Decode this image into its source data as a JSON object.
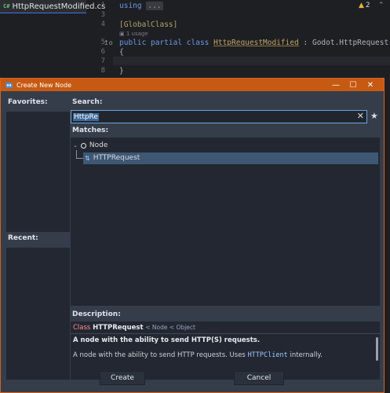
{
  "ide": {
    "tab": {
      "icon": "C#",
      "label": "HttpRequestModified.cs"
    },
    "warnings": {
      "icon": "warning-icon",
      "count": "2"
    },
    "line_numbers": [
      "1",
      "3",
      "4",
      "5",
      "6",
      "7",
      "8"
    ],
    "code": {
      "line1_keyword": "using",
      "line1_fold": "...",
      "line4_attr": "[GlobalClass]",
      "usage_hint": "1 usage",
      "line5_keywords": "public partial class",
      "line5_class": "HttpRequestModified",
      "line5_base": ": Godot.HttpRequest",
      "line6": "{",
      "line8": "}"
    }
  },
  "dialog": {
    "title": "Create New Node",
    "favorites_label": "Favorites:",
    "recent_label": "Recent:",
    "search_label": "Search:",
    "search_value": "HttpRe",
    "matches_label": "Matches:",
    "tree": {
      "root": "Node",
      "child": "HTTPRequest"
    },
    "description_label": "Description:",
    "description": {
      "class_keyword": "Class",
      "class_name": "HTTPRequest",
      "inheritance": "< Node < Object",
      "summary": "A node with the ability to send HTTP(S) requests.",
      "detail_prefix": "A node with the ability to send HTTP requests. Uses",
      "detail_code": "HTTPClient",
      "detail_suffix": "internally."
    },
    "buttons": {
      "create": "Create",
      "cancel": "Cancel"
    }
  }
}
